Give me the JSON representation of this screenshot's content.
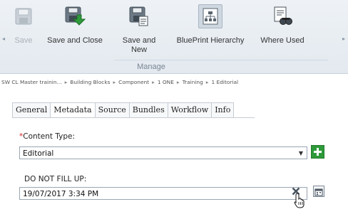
{
  "ribbon": {
    "buttons": [
      {
        "label": "Save",
        "icon": "save-icon",
        "enabled": false
      },
      {
        "label": "Save and Close",
        "icon": "save-and-close-icon",
        "enabled": true
      },
      {
        "label": "Save and\nNew",
        "icon": "save-and-new-icon",
        "enabled": true
      },
      {
        "label": "BluePrint Hierarchy",
        "icon": "blueprint-hierarchy-icon",
        "enabled": true
      },
      {
        "label": "Where Used",
        "icon": "where-used-icon",
        "enabled": true
      }
    ],
    "group_label": "Manage"
  },
  "breadcrumb": [
    "SW CL Master trainin...",
    "Building Blocks",
    "Component",
    "1 ONE",
    "Training",
    "1 Editorial"
  ],
  "breadcrumb_separator": "▸",
  "tabs": [
    "General",
    "Metadata",
    "Source",
    "Bundles",
    "Workflow",
    "Info"
  ],
  "active_tab": "Metadata",
  "form": {
    "content_type": {
      "required_mark": "*",
      "label": "Content Type:",
      "value": "Editorial"
    },
    "do_not_fill": {
      "label": "DO NOT FILL UP:",
      "value": "19/07/2017 3:34 PM"
    }
  },
  "colors": {
    "ribbon_bg": "#e3e9ef",
    "add_button": "#2e9a3a",
    "required": "#d42020",
    "clear_x": "#4a5560"
  }
}
